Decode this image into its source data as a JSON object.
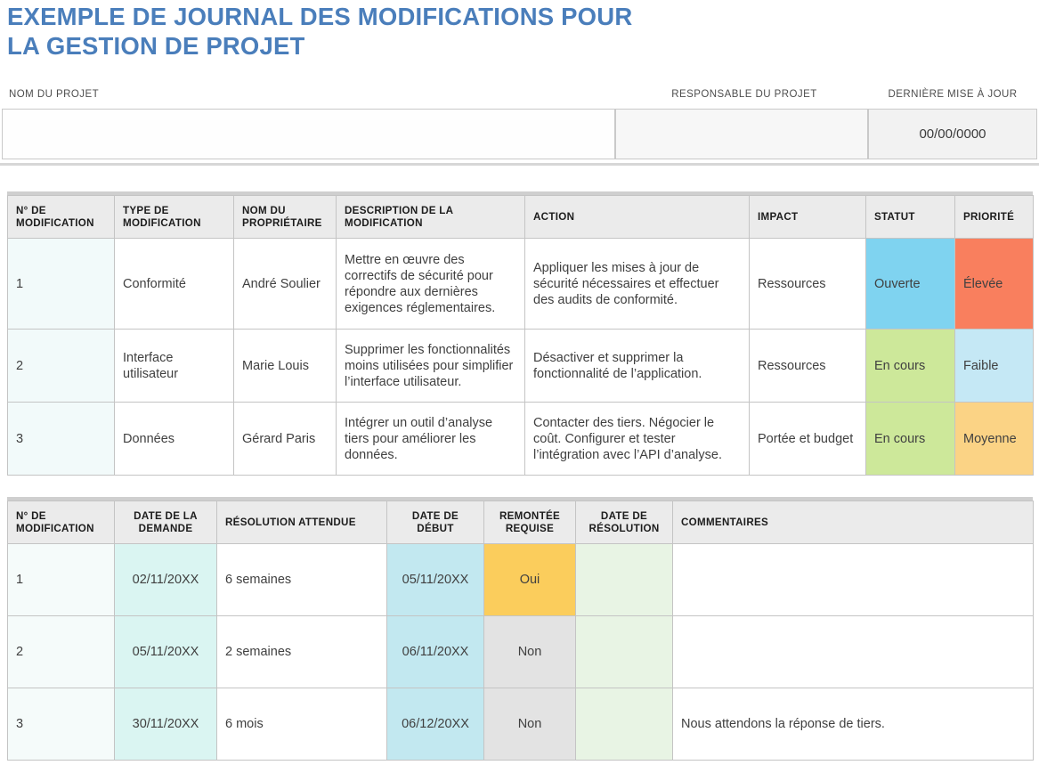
{
  "document": {
    "title_line1": "EXEMPLE DE JOURNAL DES MODIFICATIONS POUR",
    "title_line2": "LA GESTION DE PROJET",
    "title_color": "#4A7EBB"
  },
  "header": {
    "project_name_label": "NOM DU PROJET",
    "project_name_value": "",
    "project_manager_label": "RESPONSABLE DU PROJET",
    "project_manager_value": "",
    "last_update_label": "DERNIÈRE MISE À JOUR",
    "last_update_value": "00/00/0000"
  },
  "table1": {
    "columns": [
      "N° DE MODIFICATION",
      "TYPE DE MODIFICATION",
      "NOM DU PROPRIÉTAIRE",
      "DESCRIPTION DE LA MODIFICATION",
      "ACTION",
      "IMPACT",
      "STATUT",
      "PRIORITÉ"
    ],
    "rows": [
      {
        "num": "1",
        "type": "Conformité",
        "owner": "André Soulier",
        "description": "Mettre en œuvre des correctifs de sécurité pour répondre aux dernières exigences réglementaires.",
        "action": "Appliquer les mises à jour de sécurité nécessaires et effectuer des audits de conformité.",
        "impact": "Ressources",
        "statut": "Ouverte",
        "statut_color": "#7FD3F0",
        "priorite": "Élevée",
        "priorite_color": "#F97F5E"
      },
      {
        "num": "2",
        "type": "Interface utilisateur",
        "owner": "Marie Louis",
        "description": "Supprimer les fonctionnalités moins utilisées pour simplifier l’interface utilisateur.",
        "action": "Désactiver et supprimer la fonctionnalité de l’application.",
        "impact": "Ressources",
        "statut": "En cours",
        "statut_color": "#CDE89A",
        "priorite": "Faible",
        "priorite_color": "#C5E8F5"
      },
      {
        "num": "3",
        "type": "Données",
        "owner": "Gérard Paris",
        "description": "Intégrer un outil d’analyse tiers pour améliorer les données.",
        "action": "Contacter des tiers. Négocier le coût. Configurer et tester l’intégration avec l’API d’analyse.",
        "impact": "Portée et budget",
        "statut": "En cours",
        "statut_color": "#CDE89A",
        "priorite": "Moyenne",
        "priorite_color": "#FBD385"
      }
    ]
  },
  "table2": {
    "columns": [
      "N° DE MODIFICATION",
      "DATE DE LA DEMANDE",
      "RÉSOLUTION ATTENDUE",
      "DATE DE DÉBUT",
      "REMONTÉE REQUISE",
      "DATE DE RÉSOLUTION",
      "COMMENTAIRES"
    ],
    "rows": [
      {
        "num": "1",
        "date_demande": "02/11/20XX",
        "resolution_attendue": "6 semaines",
        "date_debut": "05/11/20XX",
        "remontee": "Oui",
        "remontee_color": "#FBCD5C",
        "date_resolution": "",
        "commentaires": ""
      },
      {
        "num": "2",
        "date_demande": "05/11/20XX",
        "resolution_attendue": "2 semaines",
        "date_debut": "06/11/20XX",
        "remontee": "Non",
        "remontee_color": "#E3E3E3",
        "date_resolution": "",
        "commentaires": ""
      },
      {
        "num": "3",
        "date_demande": "30/11/20XX",
        "resolution_attendue": "6 mois",
        "date_debut": "06/12/20XX",
        "remontee": "Non",
        "remontee_color": "#E3E3E3",
        "date_resolution": "",
        "commentaires": "Nous attendons la réponse de tiers."
      }
    ]
  }
}
